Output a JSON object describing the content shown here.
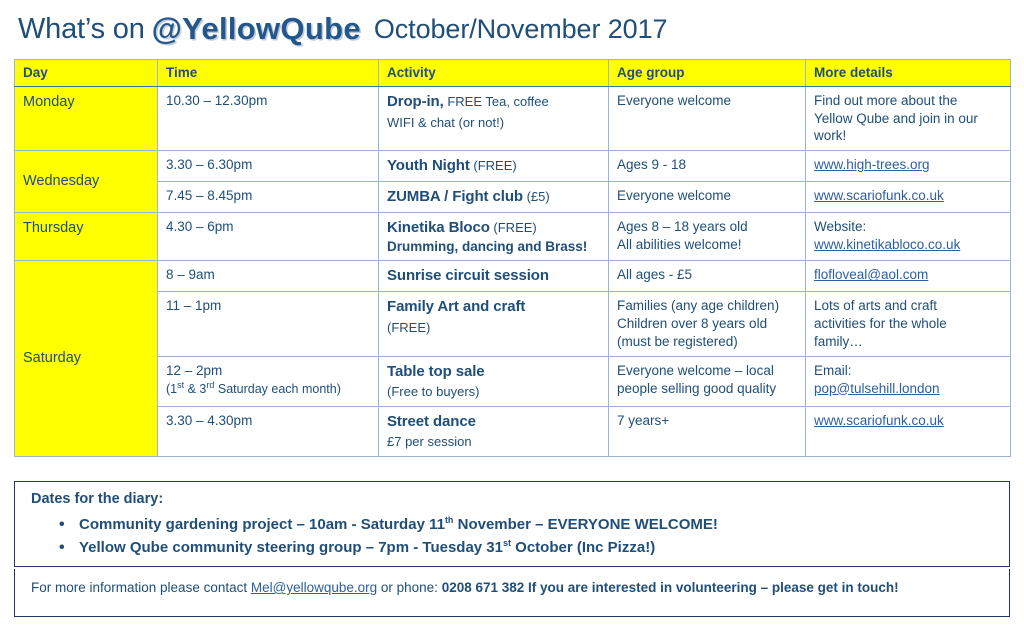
{
  "title": {
    "prefix": "What’s on",
    "brand": "@YellowQube",
    "date_range": "October/November  2017"
  },
  "colors": {
    "header_yellow": "#FFFF00",
    "navy_text": "#1F4E79",
    "link_blue": "#2E5E9E",
    "border_blue": "#9DB4D4",
    "box_border": "#1F3864"
  },
  "table": {
    "columns": [
      "Day",
      "Time",
      "Activity",
      "Age group",
      "More details"
    ],
    "rows": [
      {
        "day": "Monday",
        "day_rowspan": 1,
        "time": "10.30 – 12.30pm",
        "time_note": "",
        "activity_main": "Drop-in,",
        "activity_sub": " FREE Tea, coffee",
        "activity_line2": "WIFI & chat (or not!)",
        "activity_bold_line2": "",
        "age": [
          "Everyone welcome"
        ],
        "more": [
          "Find out more about the",
          "Yellow Qube and join in our",
          "work!"
        ],
        "more_link": "",
        "more_label": ""
      },
      {
        "day": "Wednesday",
        "day_rowspan": 2,
        "time": "3.30 – 6.30pm",
        "time_note": "",
        "activity_main": "Youth Night",
        "activity_sub": " (FREE)",
        "activity_line2": "",
        "activity_bold_line2": "",
        "age": [
          "Ages 9 - 18"
        ],
        "more": [],
        "more_link": "www.high-trees.org",
        "more_label": ""
      },
      {
        "day": "",
        "day_rowspan": 0,
        "time": "7.45 – 8.45pm",
        "time_note": "",
        "activity_main": "ZUMBA / Fight club",
        "activity_sub": " (£5)",
        "activity_line2": "",
        "activity_bold_line2": "",
        "age": [
          "Everyone welcome"
        ],
        "more": [],
        "more_link": "www.scariofunk.co.uk",
        "more_label": ""
      },
      {
        "day": "Thursday",
        "day_rowspan": 1,
        "time": "4.30 – 6pm",
        "time_note": "",
        "activity_main": "Kinetika Bloco",
        "activity_sub": "  (FREE)",
        "activity_line2": "",
        "activity_bold_line2": "Drumming, dancing and Brass!",
        "age": [
          "Ages 8 – 18 years old",
          "All abilities welcome!"
        ],
        "more": [],
        "more_link": "www.kinetikabloco.co.uk",
        "more_label": "Website:"
      },
      {
        "day": "Saturday",
        "day_rowspan": 4,
        "time": "8 – 9am",
        "time_note": "",
        "activity_main": "Sunrise circuit session",
        "activity_sub": "",
        "activity_line2": "",
        "activity_bold_line2": "",
        "age": [
          "All ages - £5"
        ],
        "more": [],
        "more_link": "flofloveal@aol.com",
        "more_label": ""
      },
      {
        "day": "",
        "day_rowspan": 0,
        "time": "11 – 1pm",
        "time_note": "",
        "activity_main": "Family Art and craft",
        "activity_sub": "",
        "activity_line2": "(FREE)",
        "activity_bold_line2": "",
        "age": [
          "Families (any age children)",
          "Children over 8 years old",
          "(must be registered)"
        ],
        "more": [
          "Lots of arts and craft",
          "activities for the whole",
          "family…"
        ],
        "more_link": "",
        "more_label": ""
      },
      {
        "day": "",
        "day_rowspan": 0,
        "time": "12 – 2pm",
        "time_note": "(1st & 3rd Saturday each month)",
        "activity_main": "Table top sale",
        "activity_sub": "",
        "activity_line2": "(Free to buyers)",
        "activity_bold_line2": "",
        "age": [
          "Everyone welcome – local",
          "people selling good quality"
        ],
        "more": [],
        "more_link": "pop@tulsehill.london",
        "more_label": "Email:"
      },
      {
        "day": "",
        "day_rowspan": 0,
        "time": "3.30 – 4.30pm",
        "time_note": "",
        "activity_main": "Street dance",
        "activity_sub": "",
        "activity_line2": "£7 per session",
        "activity_bold_line2": "",
        "age": [
          "7 years+"
        ],
        "more": [],
        "more_link": "www.scariofunk.co.uk",
        "more_label": ""
      }
    ]
  },
  "diary": {
    "heading": "Dates for the diary:",
    "items": [
      {
        "pre": "Community gardening project – 10am - Saturday 11",
        "sup": "th",
        "post": " November – EVERYONE WELCOME!"
      },
      {
        "pre": "Yellow Qube community steering group – 7pm - Tuesday 31",
        "sup": "st",
        "post": " October (Inc Pizza!)"
      }
    ]
  },
  "footer": {
    "lead": "For more information please contact ",
    "email": "Mel@yellowqube.org",
    "mid": " or phone: ",
    "phone": "0208 671 382",
    "tail": " If you are interested in volunteering – please get in touch!"
  }
}
